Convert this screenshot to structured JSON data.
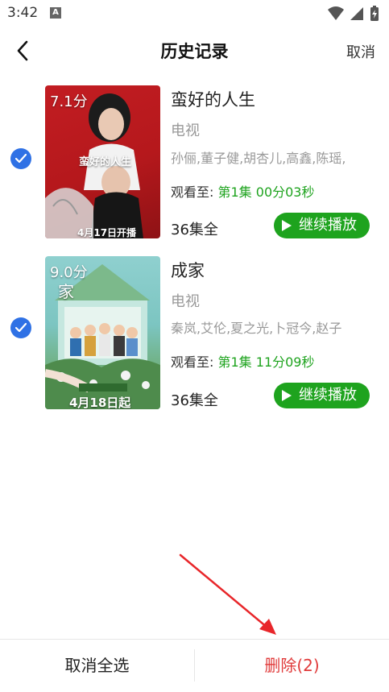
{
  "status_bar": {
    "time": "3:42",
    "notification_letter": "A"
  },
  "header": {
    "title": "历史记录",
    "cancel_label": "取消"
  },
  "items": [
    {
      "selected": true,
      "score": "7.1分",
      "poster_caption": "蛮好的人生",
      "poster_date": "4月17日开播",
      "name": "蛮好的人生",
      "type": "电视",
      "cast": "孙俪,董子健,胡杏儿,高鑫,陈瑶,",
      "watch_prefix": "观看至:",
      "watch_progress": "第1集 00分03秒",
      "episodes": "36集全",
      "play_label": "继续播放"
    },
    {
      "selected": true,
      "score": "9.0分",
      "poster_caption": "家",
      "poster_date": "4月18日起",
      "name": "成家",
      "type": "电视",
      "cast": "秦岚,艾伦,夏之光,卜冠今,赵子",
      "watch_prefix": "观看至:",
      "watch_progress": "第1集 11分09秒",
      "episodes": "36集全",
      "play_label": "继续播放"
    }
  ],
  "bottom": {
    "select_all_cancel": "取消全选",
    "delete_label": "删除(2)"
  },
  "colors": {
    "accent_green": "#1ea31e",
    "check_blue": "#2f71e5",
    "delete_red": "#e03a3a"
  }
}
